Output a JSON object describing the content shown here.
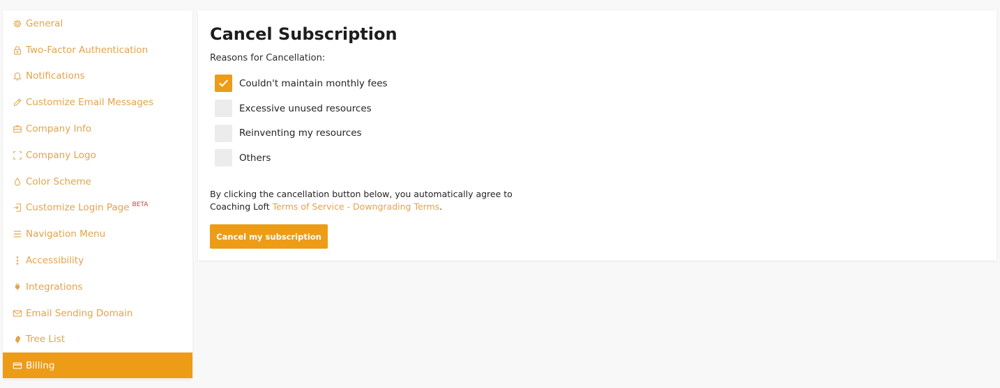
{
  "sidebar": {
    "items": [
      {
        "label": "General",
        "icon": "gear-icon"
      },
      {
        "label": "Two-Factor Authentication",
        "icon": "lock-icon"
      },
      {
        "label": "Notifications",
        "icon": "bell-icon"
      },
      {
        "label": "Customize Email Messages",
        "icon": "pencil-icon"
      },
      {
        "label": "Company Info",
        "icon": "briefcase-icon"
      },
      {
        "label": "Company Logo",
        "icon": "frame-icon"
      },
      {
        "label": "Color Scheme",
        "icon": "drop-icon"
      },
      {
        "label": "Customize Login Page",
        "icon": "login-icon",
        "badge": "BETA"
      },
      {
        "label": "Navigation Menu",
        "icon": "menu-icon"
      },
      {
        "label": "Accessibility",
        "icon": "dots-vertical-icon"
      },
      {
        "label": "Integrations",
        "icon": "plug-icon"
      },
      {
        "label": "Email Sending Domain",
        "icon": "envelope-icon"
      },
      {
        "label": "Tree List",
        "icon": "tree-icon"
      },
      {
        "label": "Billing",
        "icon": "credit-card-icon",
        "active": true
      }
    ]
  },
  "main": {
    "title": "Cancel Subscription",
    "reasons_label": "Reasons for Cancellation:",
    "options": [
      {
        "label": "Couldn't maintain monthly fees",
        "checked": true
      },
      {
        "label": "Excessive unused resources",
        "checked": false
      },
      {
        "label": "Reinventing my resources",
        "checked": false
      },
      {
        "label": "Others",
        "checked": false
      }
    ],
    "agreement_text_1": "By clicking the cancellation button below, you automatically agree to",
    "agreement_text_2": "Coaching Loft ",
    "agreement_link": "Terms of Service - Downgrading Terms",
    "agreement_end": ".",
    "cancel_button": "Cancel my subscription"
  },
  "colors": {
    "accent": "#ec9c17",
    "link": "#e2a34b",
    "beta_badge": "#d43c3c"
  }
}
